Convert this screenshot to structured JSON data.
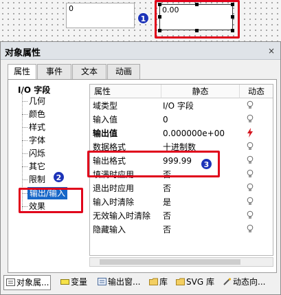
{
  "canvas": {
    "field1_value": "0",
    "field2_value": "0.00"
  },
  "badges": [
    "1",
    "2",
    "3"
  ],
  "panel": {
    "title": "对象属性",
    "close": "×",
    "tabs": [
      "属性",
      "事件",
      "文本",
      "动画"
    ]
  },
  "tree": {
    "root": "I/O 字段",
    "items": [
      "几何",
      "颜色",
      "样式",
      "字体",
      "闪烁",
      "其它",
      "限制",
      "输出/输入",
      "效果"
    ]
  },
  "grid": {
    "headers": [
      "属性",
      "静态",
      "动态"
    ],
    "rows": [
      {
        "name": "域类型",
        "value": "I/O 字段",
        "bold": false,
        "dyn": "bulb"
      },
      {
        "name": "输入值",
        "value": "0",
        "bold": false,
        "dyn": "bulb"
      },
      {
        "name": "输出值",
        "value": "0.000000e+00",
        "bold": true,
        "dyn": "lightning"
      },
      {
        "name": "数据格式",
        "value": "十进制数",
        "bold": false,
        "dyn": "bulb"
      },
      {
        "name": "输出格式",
        "value": "999.99",
        "bold": false,
        "dyn": "bulb"
      },
      {
        "name": "填满时应用",
        "value": "否",
        "bold": false,
        "dyn": "bulb"
      },
      {
        "name": "退出时应用",
        "value": "否",
        "bold": false,
        "dyn": "bulb"
      },
      {
        "name": "输入时清除",
        "value": "是",
        "bold": false,
        "dyn": "bulb"
      },
      {
        "name": "无效输入时清除",
        "value": "否",
        "bold": false,
        "dyn": "bulb"
      },
      {
        "name": "隐藏输入",
        "value": "否",
        "bold": false,
        "dyn": "bulb"
      }
    ]
  },
  "bottom_tabs": [
    "对象属...",
    "变量",
    "输出窗...",
    "库",
    "SVG 库",
    "动态向..."
  ],
  "colors": {
    "highlight_red": "#e0001a",
    "badge_blue": "#1c33b8",
    "selection_blue": "#1667c8",
    "lightning_red": "#d4141e"
  }
}
